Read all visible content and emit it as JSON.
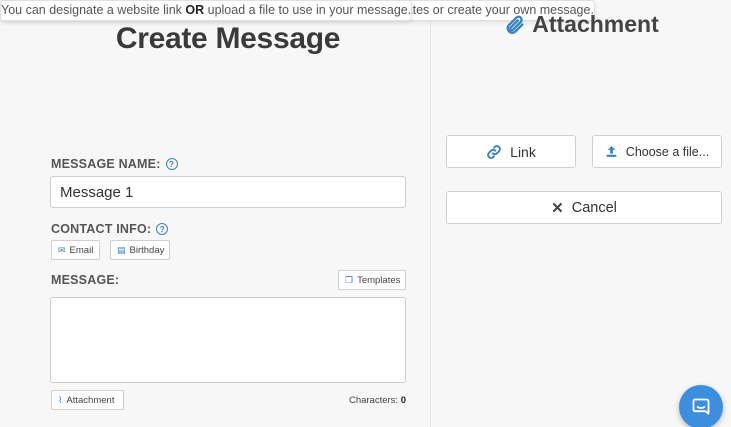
{
  "create": {
    "title": "Create Message",
    "info": "You can collect user information through pre-populated contact info templates or create your own message.",
    "message_name_label": "MESSAGE NAME:",
    "message_name_value": "Message 1",
    "contact_info_label": "CONTACT INFO:",
    "chips": [
      "Email",
      "Birthday"
    ],
    "message_label": "MESSAGE:",
    "templates_button": "Templates",
    "attachment_button": "Attachment",
    "characters_label": "Characters:",
    "characters_count": "0"
  },
  "attachment_panel": {
    "title": "Attachment",
    "info_prefix": "You can designate a website link ",
    "info_bold": "OR",
    "info_suffix": " upload a file to use in your message.",
    "link_button": "Link",
    "file_button": "Choose a file...",
    "cancel_button": "Cancel"
  },
  "colors": {
    "accent": "#3b82c4",
    "chat_button": "#3e8ede"
  }
}
